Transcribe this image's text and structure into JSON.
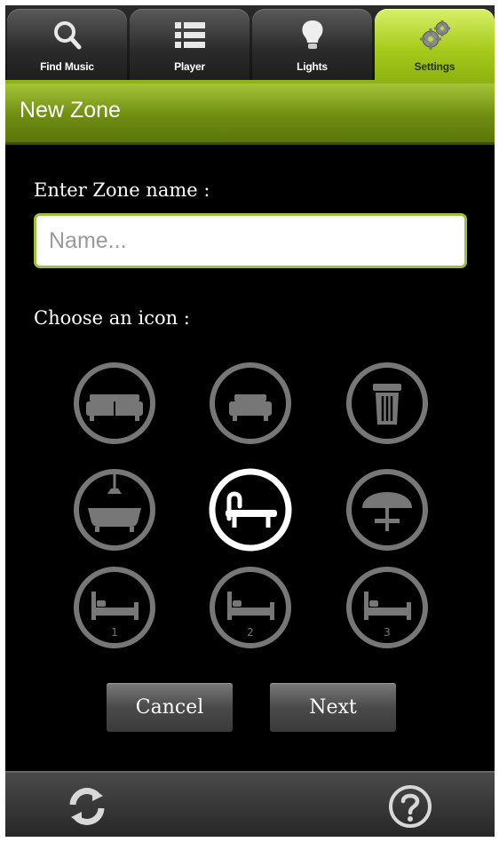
{
  "tabs": [
    {
      "label": "Find Music",
      "icon": "search-icon"
    },
    {
      "label": "Player",
      "icon": "list-icon"
    },
    {
      "label": "Lights",
      "icon": "lightbulb-icon"
    },
    {
      "label": "Settings",
      "icon": "gears-icon",
      "active": true
    }
  ],
  "header": {
    "title": "New Zone"
  },
  "form": {
    "name_label": "Enter Zone name :",
    "name_value": "",
    "name_placeholder": "Name...",
    "icon_label": "Choose an icon :"
  },
  "zone_icons": [
    {
      "icon": "sofa-icon",
      "selected": false
    },
    {
      "icon": "small-sofa-icon",
      "selected": false
    },
    {
      "icon": "trash-bin-icon",
      "selected": false
    },
    {
      "icon": "bathtub-icon",
      "selected": false
    },
    {
      "icon": "lounger-icon",
      "selected": true
    },
    {
      "icon": "parasol-table-icon",
      "selected": false
    },
    {
      "icon": "bed-1-icon",
      "number": "1",
      "selected": false
    },
    {
      "icon": "bed-2-icon",
      "number": "2",
      "selected": false
    },
    {
      "icon": "bed-3-icon",
      "number": "3",
      "selected": false
    }
  ],
  "buttons": {
    "cancel": "Cancel",
    "next": "Next"
  },
  "bottom_bar": {
    "left_icon": "refresh-icon",
    "right_icon": "help-icon"
  },
  "colors": {
    "accent": "#a8cc1c",
    "selected_icon": "#ffffff",
    "icon_gray": "#777777"
  }
}
